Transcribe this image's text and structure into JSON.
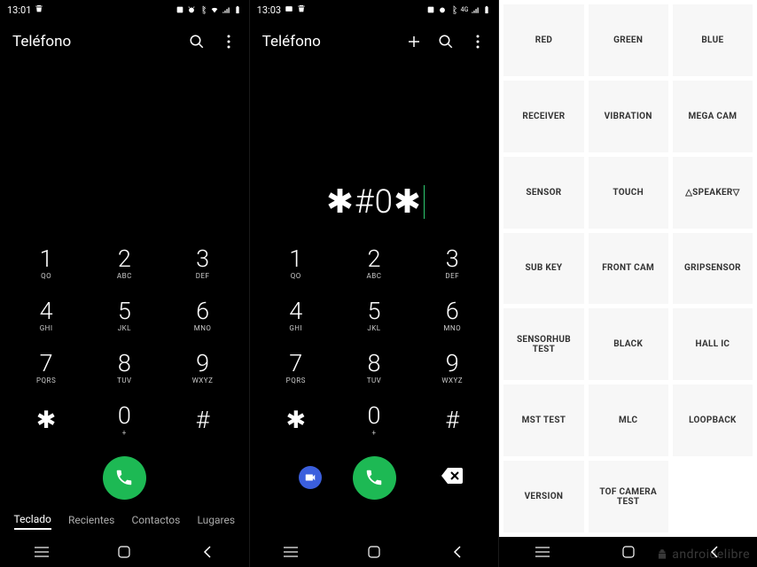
{
  "panel1": {
    "status": {
      "time": "13:01"
    },
    "header": {
      "title": "Teléfono"
    },
    "keypad": [
      {
        "num": "1",
        "letters": "QO"
      },
      {
        "num": "2",
        "letters": "ABC"
      },
      {
        "num": "3",
        "letters": "DEF"
      },
      {
        "num": "4",
        "letters": "GHI"
      },
      {
        "num": "5",
        "letters": "JKL"
      },
      {
        "num": "6",
        "letters": "MNO"
      },
      {
        "num": "7",
        "letters": "PQRS"
      },
      {
        "num": "8",
        "letters": "TUV"
      },
      {
        "num": "9",
        "letters": "WXYZ"
      },
      {
        "num": "✱",
        "letters": ""
      },
      {
        "num": "0",
        "letters": "+"
      },
      {
        "num": "#",
        "letters": ""
      }
    ],
    "tabs": [
      {
        "label": "Teclado",
        "active": true
      },
      {
        "label": "Recientes",
        "active": false
      },
      {
        "label": "Contactos",
        "active": false
      },
      {
        "label": "Lugares",
        "active": false
      }
    ]
  },
  "panel2": {
    "status": {
      "time": "13:03"
    },
    "header": {
      "title": "Teléfono"
    },
    "dialed": "✱#0✱",
    "keypad": [
      {
        "num": "1",
        "letters": "QO"
      },
      {
        "num": "2",
        "letters": "ABC"
      },
      {
        "num": "3",
        "letters": "DEF"
      },
      {
        "num": "4",
        "letters": "GHI"
      },
      {
        "num": "5",
        "letters": "JKL"
      },
      {
        "num": "6",
        "letters": "MNO"
      },
      {
        "num": "7",
        "letters": "PQRS"
      },
      {
        "num": "8",
        "letters": "TUV"
      },
      {
        "num": "9",
        "letters": "WXYZ"
      },
      {
        "num": "✱",
        "letters": ""
      },
      {
        "num": "0",
        "letters": "+"
      },
      {
        "num": "#",
        "letters": ""
      }
    ]
  },
  "panel3": {
    "items": [
      "RED",
      "GREEN",
      "BLUE",
      "RECEIVER",
      "VIBRATION",
      "MEGA CAM",
      "SENSOR",
      "TOUCH",
      "△SPEAKER▽",
      "SUB KEY",
      "FRONT CAM",
      "GRIPSENSOR",
      "SENSORHUB TEST",
      "BLACK",
      "HALL IC",
      "MST TEST",
      "MLC",
      "LOOPBACK",
      "VERSION",
      "TOF CAMERA TEST",
      ""
    ]
  },
  "watermark": "androidelibre"
}
